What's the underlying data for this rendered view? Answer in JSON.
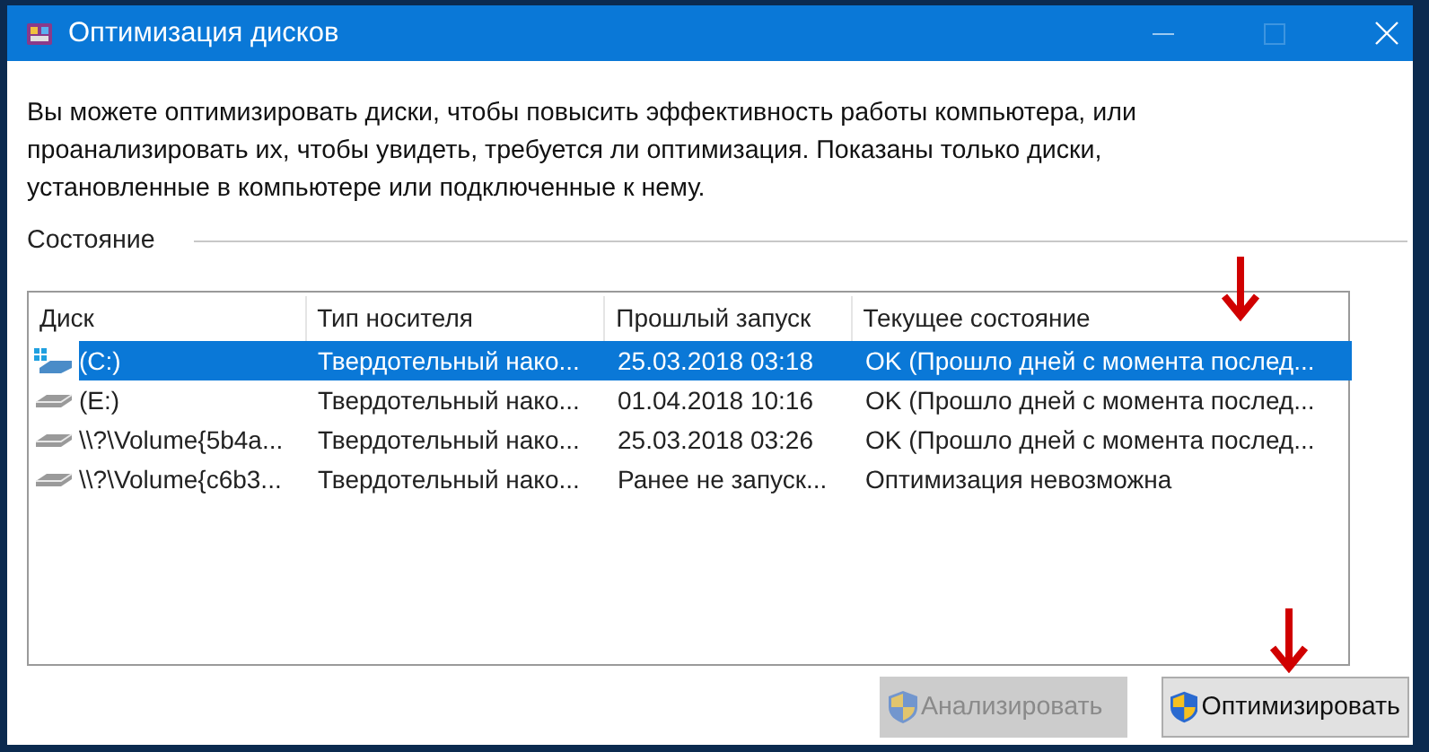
{
  "window": {
    "title": "Оптимизация дисков"
  },
  "description": "Вы можете оптимизировать диски, чтобы повысить эффективность работы  компьютера, или проанализировать их, чтобы увидеть, требуется ли оптимизация. Показаны только диски, установленные в компьютере или подключенные к нему.",
  "section_label": "Состояние",
  "table": {
    "columns": [
      "Диск",
      "Тип носителя",
      "Прошлый запуск",
      "Текущее состояние"
    ],
    "rows": [
      {
        "kind": "system",
        "selected": true,
        "cells": [
          "(C:)",
          "Твердотельный нако...",
          "25.03.2018 03:18",
          "OK (Прошло дней с момента послед..."
        ]
      },
      {
        "kind": "drive",
        "selected": false,
        "cells": [
          "(E:)",
          "Твердотельный нако...",
          "01.04.2018 10:16",
          "OK (Прошло дней с момента послед..."
        ]
      },
      {
        "kind": "drive",
        "selected": false,
        "cells": [
          "\\\\?\\Volume{5b4a...",
          "Твердотельный нако...",
          "25.03.2018 03:26",
          "OK (Прошло дней с момента послед..."
        ]
      },
      {
        "kind": "drive",
        "selected": false,
        "cells": [
          "\\\\?\\Volume{c6b3...",
          "Твердотельный нако...",
          "Ранее не запуск...",
          "Оптимизация невозможна"
        ]
      }
    ]
  },
  "buttons": [
    {
      "label": "Анализировать",
      "disabled": true
    },
    {
      "label": "Оптимизировать",
      "disabled": false
    }
  ]
}
